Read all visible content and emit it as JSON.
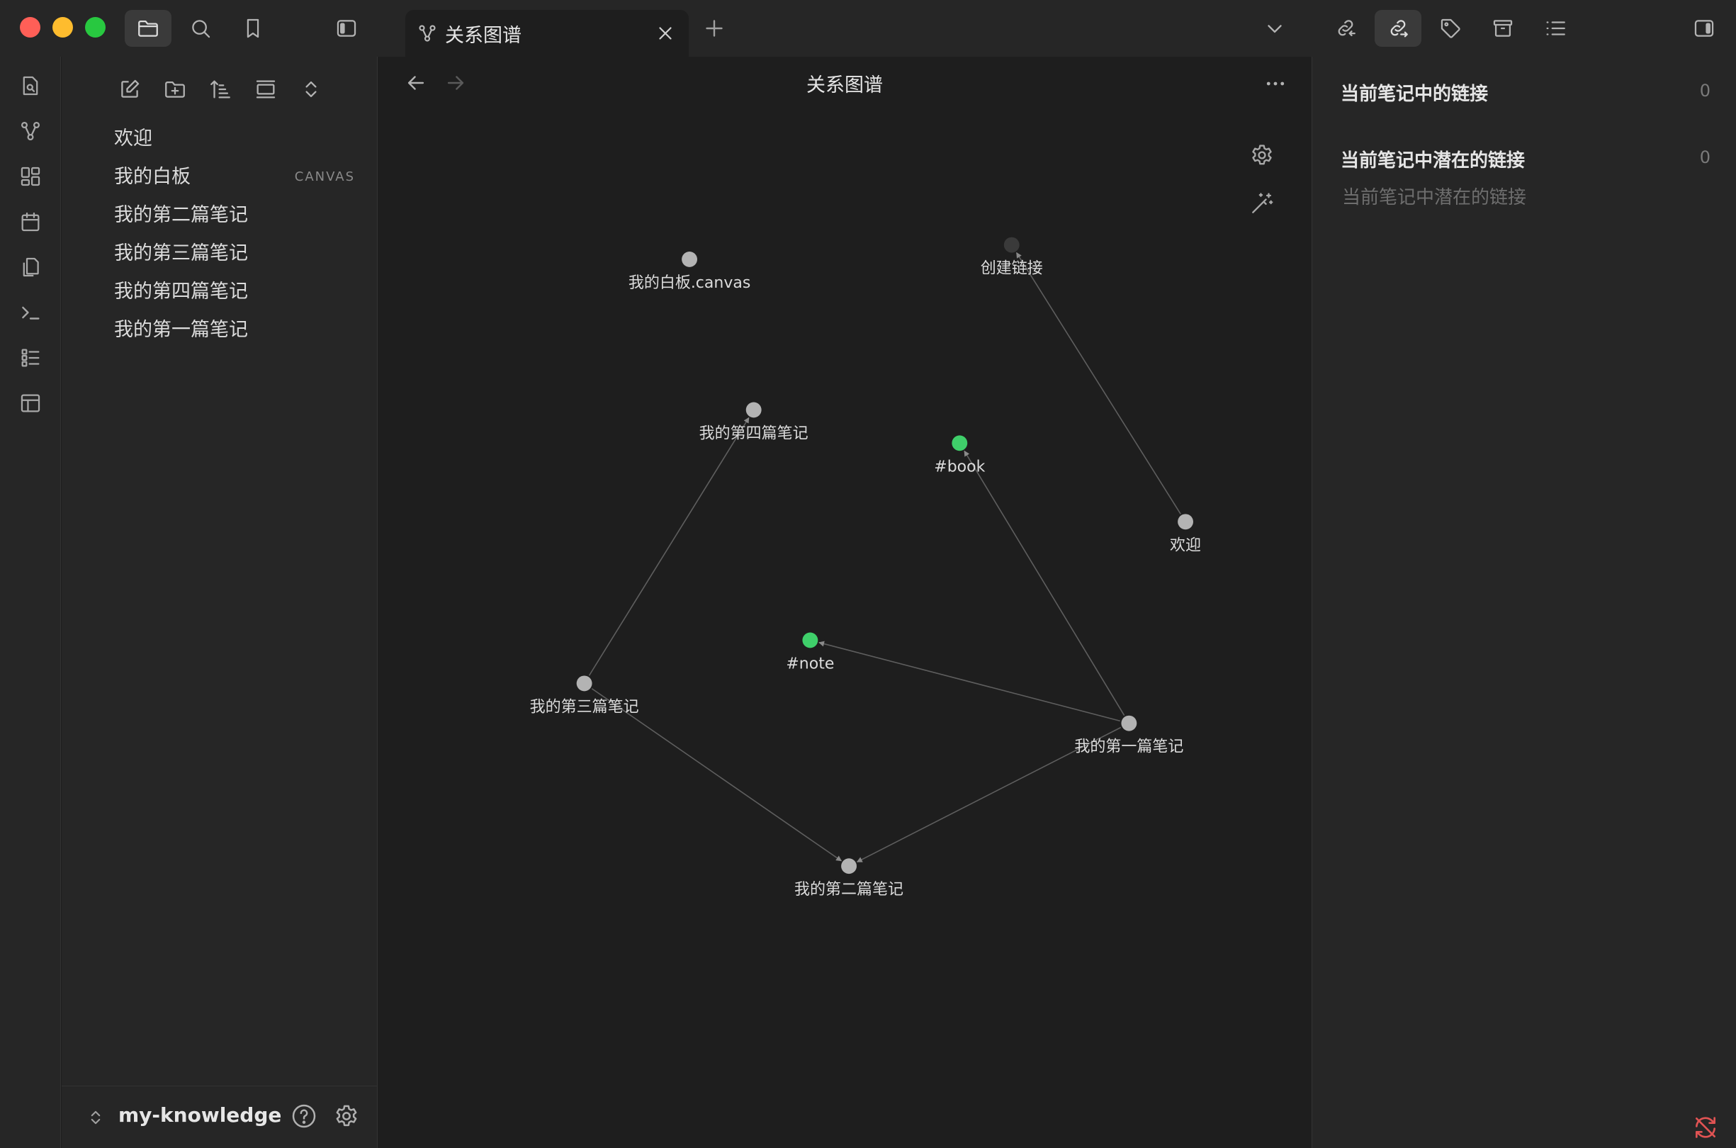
{
  "window": {
    "title": "关系图谱"
  },
  "titlebar": {
    "icons": [
      "folder-icon",
      "search-icon",
      "bookmark-icon",
      "sidebar-left-icon",
      "chevron-down-icon",
      "backlinks-icon",
      "outgoing-links-icon",
      "tag-icon",
      "archive-icon",
      "outline-icon",
      "sidebar-right-icon"
    ]
  },
  "tab": {
    "label": "关系图谱",
    "icon": "graph-icon"
  },
  "ribbon": {
    "icons": [
      "quick-switcher-icon",
      "graph-view-icon",
      "canvas-icon",
      "daily-note-icon",
      "templates-icon",
      "command-palette-icon",
      "outline-view-icon",
      "layout-icon"
    ]
  },
  "sidebar": {
    "files": [
      {
        "name": "欢迎",
        "badge": ""
      },
      {
        "name": "我的白板",
        "badge": "CANVAS"
      },
      {
        "name": "我的第二篇笔记",
        "badge": ""
      },
      {
        "name": "我的第三篇笔记",
        "badge": ""
      },
      {
        "name": "我的第四篇笔记",
        "badge": ""
      },
      {
        "name": "我的第一篇笔记",
        "badge": ""
      }
    ],
    "vault_name": "my-knowledge"
  },
  "main": {
    "title": "关系图谱",
    "graph": {
      "nodes": [
        {
          "id": "canvas",
          "label": "我的白板.canvas",
          "color": "#b3b3b3"
        },
        {
          "id": "create",
          "label": "创建链接",
          "color": "#3a3a3a"
        },
        {
          "id": "fourth",
          "label": "我的第四篇笔记",
          "color": "#b3b3b3"
        },
        {
          "id": "book",
          "label": "#book",
          "color": "#3fcf6a"
        },
        {
          "id": "welcome",
          "label": "欢迎",
          "color": "#b3b3b3"
        },
        {
          "id": "note",
          "label": "#note",
          "color": "#3fcf6a"
        },
        {
          "id": "third",
          "label": "我的第三篇笔记",
          "color": "#b3b3b3"
        },
        {
          "id": "first",
          "label": "我的第一篇笔记",
          "color": "#b3b3b3"
        },
        {
          "id": "second",
          "label": "我的第二篇笔记",
          "color": "#b3b3b3"
        }
      ],
      "edges": [
        {
          "from": "welcome",
          "to": "create"
        },
        {
          "from": "third",
          "to": "fourth"
        },
        {
          "from": "first",
          "to": "book"
        },
        {
          "from": "first",
          "to": "note"
        },
        {
          "from": "third",
          "to": "second"
        },
        {
          "from": "first",
          "to": "second"
        }
      ]
    }
  },
  "right_sidebar": {
    "outgoing_links_title": "当前笔记中的链接",
    "outgoing_links_count": "0",
    "unlinked_title": "当前笔记中潜在的链接",
    "unlinked_count": "0",
    "unlinked_placeholder": "当前笔记中潜在的链接"
  }
}
